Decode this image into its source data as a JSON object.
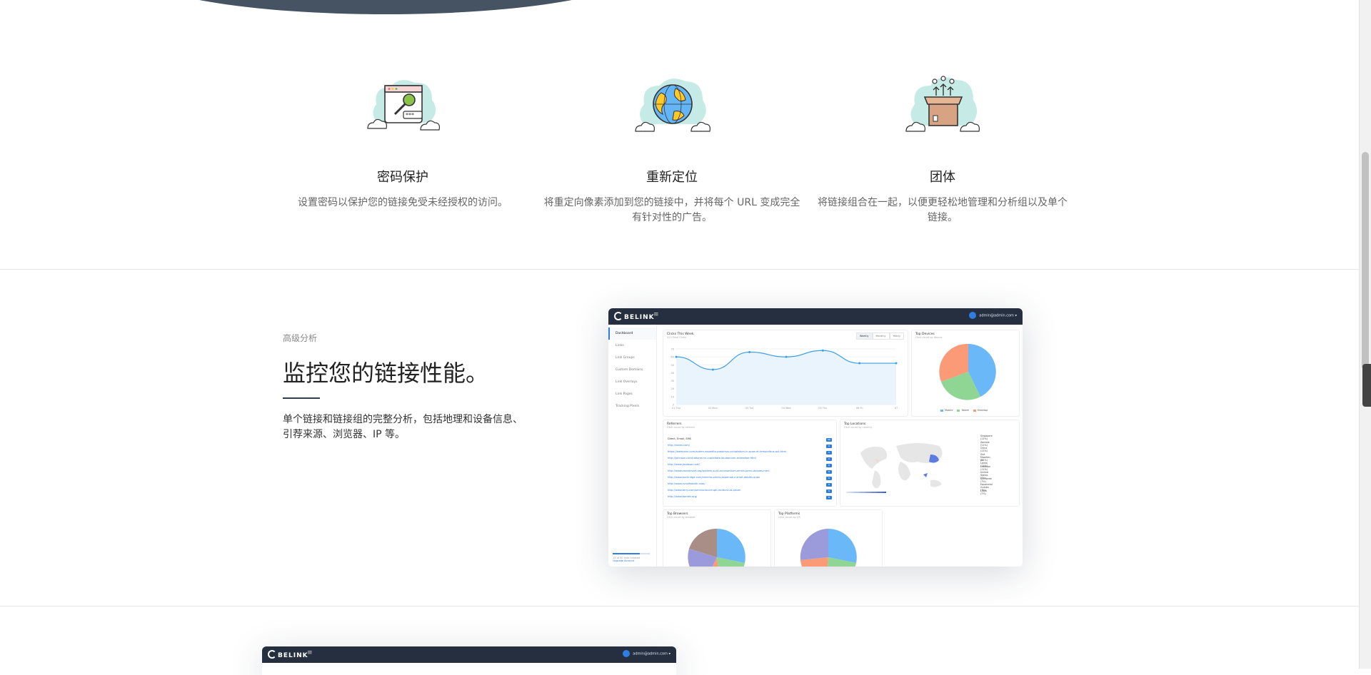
{
  "features": [
    {
      "title": "密码保护",
      "desc": "设置密码以保护您的链接免受未经授权的访问。",
      "icon": "key-window-icon"
    },
    {
      "title": "重新定位",
      "desc": "将重定向像素添加到您的链接中，并将每个 URL 变成完全有针对性的广告。",
      "icon": "globe-icon"
    },
    {
      "title": "团体",
      "desc": "将链接组合在一起，以便更轻松地管理和分析组以及单个链接。",
      "icon": "box-group-icon"
    }
  ],
  "analytics": {
    "eyebrow": "高级分析",
    "title": "监控您的链接性能。",
    "desc": "单个链接和链接组的完整分析，包括地理和设备信息、引荐来源、浏览器、IP 等。"
  },
  "dashboard": {
    "brand": "BELINK",
    "menu_glyph": "≡",
    "user": "admin@admin.com ▾",
    "sidebar": [
      "Dashboard",
      "Links",
      "Link Groups",
      "Custom Domains",
      "Link Overlays",
      "Link Pages",
      "Tracking Pixels"
    ],
    "footer_usage": "15 of 50 links created",
    "footer_upgrade": "Upgrade Account",
    "clicks": {
      "title": "Clicks This Week",
      "sub": "413 Total Clicks",
      "toggles": [
        "Weekly",
        "Monthly",
        "Yearly"
      ],
      "active_toggle": "Weekly"
    },
    "devices": {
      "title": "Top Devices",
      "sub": "Click count by device",
      "legend": [
        "Mobile",
        "Tablet",
        "Desktop"
      ],
      "colors": [
        "#6ab8f7",
        "#8fd694",
        "#fa9a77"
      ]
    },
    "referrers": {
      "title": "Referrers",
      "sub": "Click count by referrer",
      "rows": [
        {
          "url": "Direct, Email, SMS",
          "count": "96"
        },
        {
          "url": "http://nolan.com/",
          "count": "9"
        },
        {
          "url": "https://weimann.com/autem-expedita-possimus-voluptatum-in-quae-et-temporibus-aut.html",
          "count": "9"
        },
        {
          "url": "http://johnson.com/ratione-hic-cupiditate-laudantium-molestiae.html",
          "count": "9"
        },
        {
          "url": "http://www.jacobson.net/",
          "count": "8"
        },
        {
          "url": "http://www.vandervort.org/quidem-sunt-accusantium-omnis-porro-dolores.html",
          "count": "8"
        },
        {
          "url": "http://www.buckridge.com/minima-omnis-aspernatur-amet-debitis-quas",
          "count": "8"
        },
        {
          "url": "http://www.runolfsdottir.com/",
          "count": "8"
        },
        {
          "url": "http://www.terry.com/ommuniscorrupti-incidunt-at-ipsum",
          "count": "8"
        },
        {
          "url": "http://www.barrett.org/",
          "count": "8"
        }
      ]
    },
    "locations": {
      "title": "Top Locations",
      "sub": "Click count by country",
      "rows": [
        "Singapore (11%)",
        "Zambia (11%)",
        "China (11%)",
        "Sint Maarten (11%)",
        "Sri Lanka (11%)",
        "Lebanon (11%)",
        "United States (7%)",
        "Suriname (7%)",
        "Equatorial Guinea (7%)",
        "Libya (7%)"
      ]
    },
    "browsers": {
      "title": "Top Browsers",
      "sub": "Click count by browser",
      "colors": [
        "#6ab8f7",
        "#8fd694",
        "#fa9a77",
        "#9b9bdc",
        "#a88e86"
      ]
    },
    "platforms": {
      "title": "Top Platforms",
      "sub": "Click count by OS",
      "colors": [
        "#6ab8f7",
        "#8fd694",
        "#fa9a77",
        "#9b9bdc"
      ]
    },
    "chart_data": {
      "type": "line",
      "categories": [
        "01 Thu",
        "02 Mon",
        "03 Tue",
        "04 Wed",
        "05 Thu",
        "06 Fri",
        "07"
      ],
      "values": [
        60,
        44,
        66,
        60,
        68,
        52,
        52
      ],
      "ylim": [
        0,
        70
      ],
      "yticks": [
        "0",
        "10",
        "20",
        "30",
        "40",
        "50",
        "60",
        "70"
      ]
    }
  },
  "second_dash": {
    "brand": "BELINK",
    "menu_glyph": "≡",
    "user": "admin@admin.com ▾"
  }
}
